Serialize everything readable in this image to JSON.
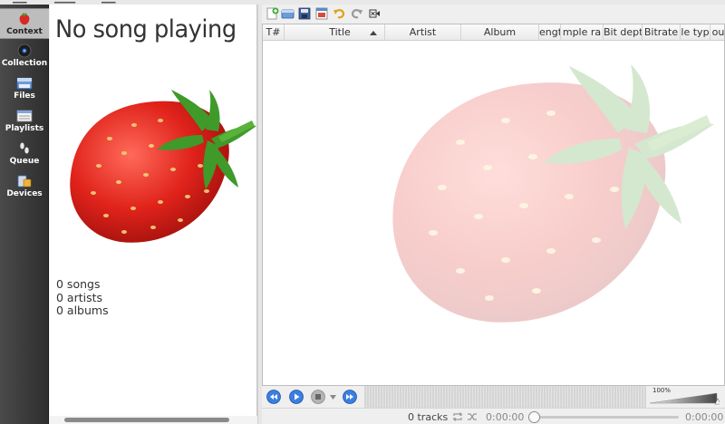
{
  "sidebar": {
    "items": [
      {
        "label": "Context",
        "icon": "strawberry-icon"
      },
      {
        "label": "Collection",
        "icon": "disc-icon"
      },
      {
        "label": "Files",
        "icon": "folder-icon"
      },
      {
        "label": "Playlists",
        "icon": "playlist-icon"
      },
      {
        "label": "Queue",
        "icon": "footsteps-icon"
      },
      {
        "label": "Devices",
        "icon": "devices-icon"
      }
    ]
  },
  "context": {
    "title": "No song playing",
    "stats": [
      "0 songs",
      "0 artists",
      "0 albums"
    ]
  },
  "toolbar": {
    "icons": [
      "new-playlist-icon",
      "load-playlist-icon",
      "save-playlist-icon",
      "edit-playlist-icon",
      "undo-icon",
      "redo-icon",
      "clear-playlist-icon"
    ]
  },
  "playlist": {
    "columns": [
      "T#",
      "Title",
      "Artist",
      "Album",
      "Length",
      "Sample rate",
      "Bit depth",
      "Bitrate",
      "File type",
      "Source"
    ],
    "visible_columns": [
      "T#",
      "Title",
      "Artist",
      "Album",
      "engt",
      "mple ra",
      "Bit deptl",
      "Bitrate",
      "le typ",
      "ou"
    ],
    "rows": []
  },
  "player": {
    "volume_label": "100%"
  },
  "status": {
    "tracks": "0 tracks",
    "time_elapsed": "0:00:00",
    "time_total": "0:00:00"
  },
  "colors": {
    "accent": "#2f6ed8",
    "strawberry": "#d82a25",
    "leaf": "#3f9a2a",
    "sidebar": "#3c3c3c"
  }
}
